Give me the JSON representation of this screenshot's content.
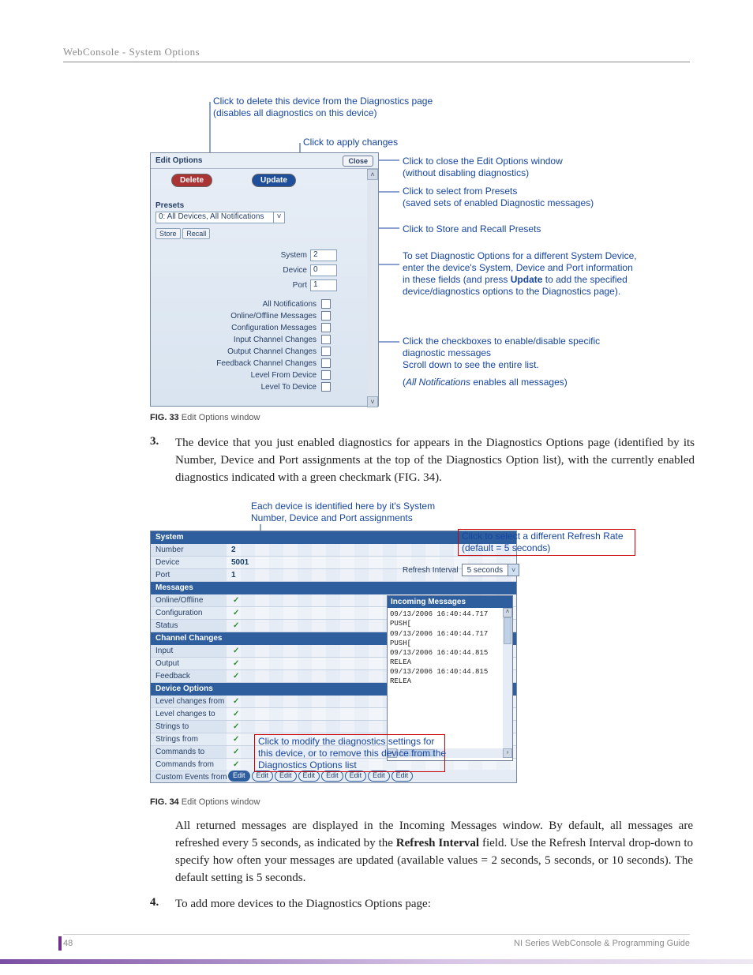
{
  "header": {
    "breadcrumb": "WebConsole - System Options"
  },
  "fig33": {
    "callouts": {
      "delete": "Click to delete this device from the Diagnostics page\n(disables all diagnostics on this device)",
      "apply": "Click to apply changes",
      "close": "Click to close the Edit Options window\n(without disabling diagnostics)",
      "presets": "Click to select from Presets\n(saved sets of enabled Diagnostic messages)",
      "store": "Click to Store and Recall Presets",
      "device1": "To set Diagnostic Options for a different System Device, enter the device's System, Device and Port information in these fields (and press ",
      "device_bold": "Update",
      "device2": " to add the specified device/diagnostics options to the Diagnostics page).",
      "chk1": "Click the checkboxes to enable/disable specific diagnostic messages\nScroll down to see the entire list.",
      "chk2_a": "(",
      "chk2_i": "All Notifications",
      "chk2_b": " enables all messages)"
    },
    "panel": {
      "title": "Edit Options",
      "close": "Close",
      "delete": "Delete",
      "update": "Update",
      "presets_label": "Presets",
      "presets_value": "0: All Devices, All Notifications",
      "store": "Store",
      "recall": "Recall",
      "sys_label": "System",
      "sys_val": "2",
      "dev_label": "Device",
      "dev_val": "0",
      "port_label": "Port",
      "port_val": "1",
      "chk_labels": [
        "All Notifications",
        "Online/Offline Messages",
        "Configuration Messages",
        "Input Channel Changes",
        "Output Channel Changes",
        "Feedback Channel Changes",
        "Level From Device",
        "Level To Device"
      ]
    },
    "caption_b": "FIG. 33",
    "caption_t": "  Edit Options window"
  },
  "step3": {
    "n": "3.",
    "text": "The device that you just enabled diagnostics for appears in the Diagnostics Options page (identified by its Number, Device and Port assignments at the top of the Diagnostics Option list), with the currently enabled diagnostics indicated with a green checkmark (FIG. 34)."
  },
  "fig34": {
    "callouts": {
      "top": "Each device is identified here by it's System\nNumber, Device and Port assignments",
      "refresh": "Click to select a different Refresh Rate\n(default = 5 seconds)",
      "edit": "Click to modify the diagnostics settings for this device, or to remove this device from the Diagnostics Options list"
    },
    "system_hdr": "System",
    "rows_system": [
      {
        "label": "Number",
        "val": "2"
      },
      {
        "label": "Device",
        "val": "5001"
      },
      {
        "label": "Port",
        "val": "1"
      }
    ],
    "messages_hdr": "Messages",
    "rows_messages": [
      "Online/Offline",
      "Configuration",
      "Status"
    ],
    "channel_hdr": "Channel Changes",
    "rows_channel": [
      "Input",
      "Output",
      "Feedback"
    ],
    "devopt_hdr": "Device Options",
    "rows_devopt": [
      "Level changes from",
      "Level changes to",
      "Strings to",
      "Strings from",
      "Commands to",
      "Commands from",
      "Custom Events from"
    ],
    "edit_label": "Edit",
    "refresh_label": "Refresh Interval",
    "refresh_value": "5 seconds",
    "msg_title": "Incoming Messages",
    "msg_lines": [
      "09/13/2006 16:40:44.717 PUSH[",
      "09/13/2006 16:40:44.717 PUSH[",
      "09/13/2006 16:40:44.815 RELEA",
      "09/13/2006 16:40:44.815 RELEA"
    ],
    "caption_b": "FIG. 34",
    "caption_t": "  Edit Options window"
  },
  "para_after": {
    "a": "All returned messages are displayed in the Incoming Messages window. By default, all messages are refreshed every 5 seconds, as indicated by the ",
    "bold": "Refresh Interval",
    "b": " field. Use the Refresh Interval drop-down to specify how often your messages are updated (available values = 2 seconds, 5 seconds, or 10 seconds). The default setting is 5 seconds."
  },
  "step4": {
    "n": "4.",
    "text": "To add more devices to the Diagnostics Options page:"
  },
  "footer": {
    "page": "48",
    "title": "NI Series WebConsole & Programming Guide"
  }
}
